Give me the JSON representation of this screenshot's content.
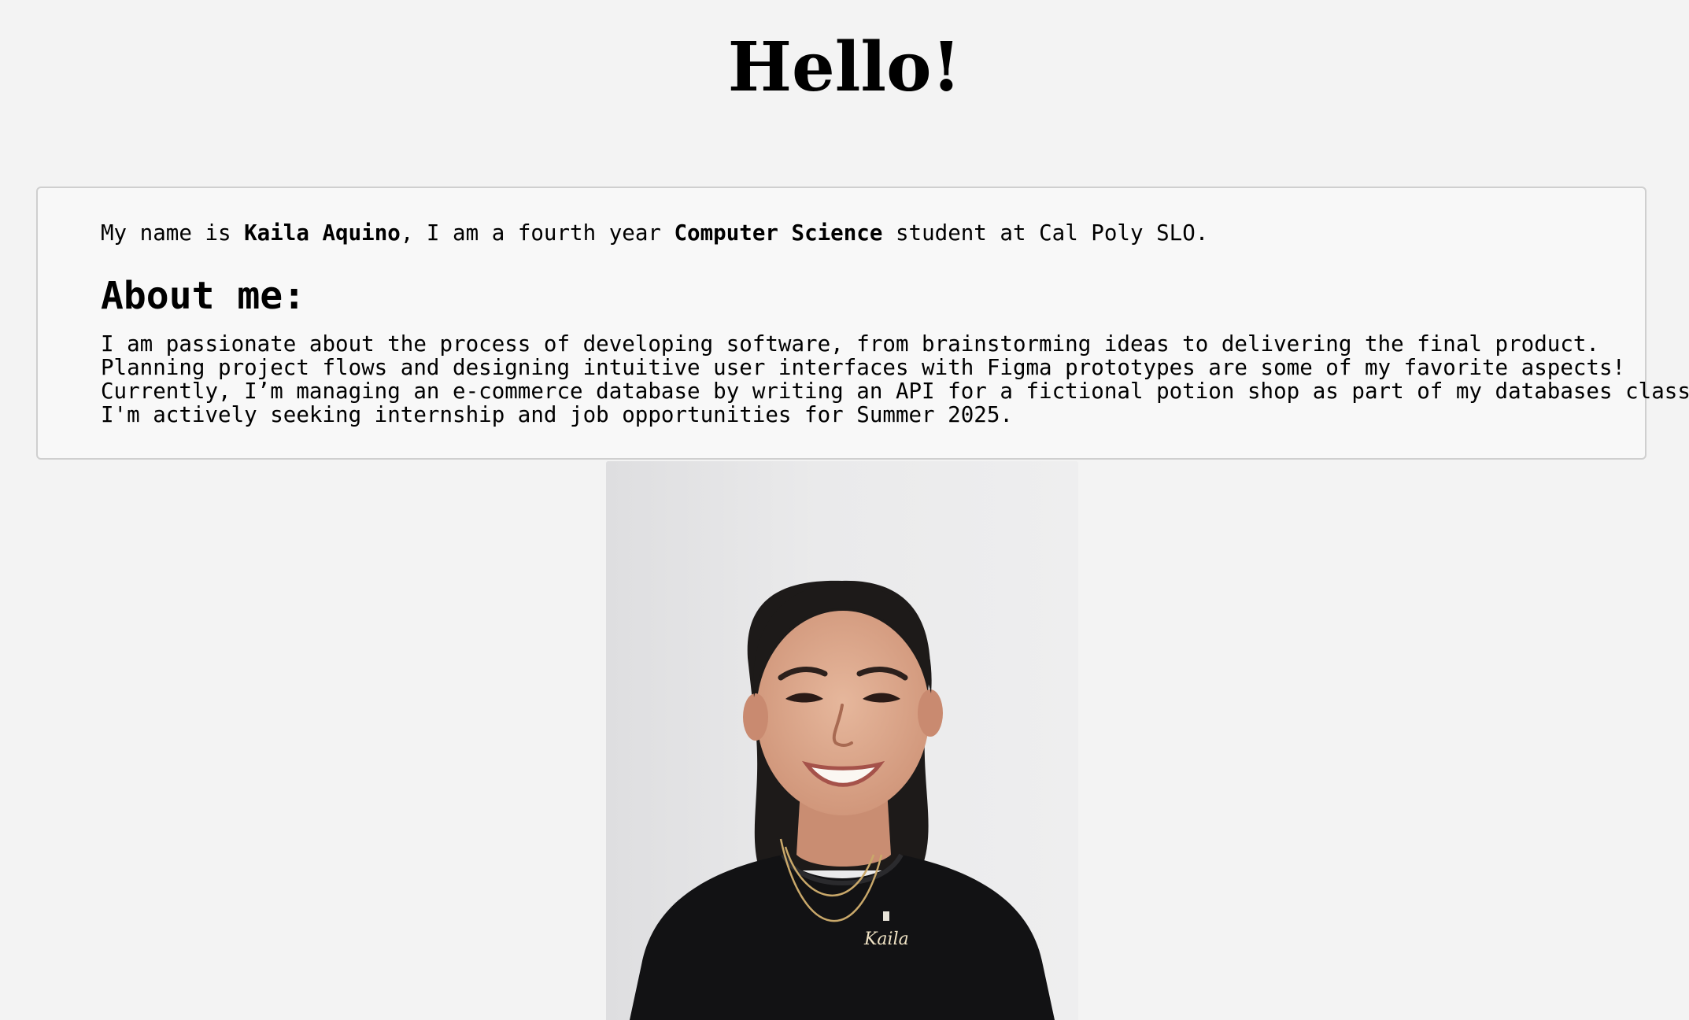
{
  "header": {
    "title": "Hello!"
  },
  "intro": {
    "prefix": "My name is ",
    "name": "Kaila Aquino",
    "middle": ", I am a fourth year ",
    "major": "Computer Science",
    "suffix": " student at Cal Poly SLO."
  },
  "about": {
    "heading": "About me:",
    "lines": [
      "I am passionate about the process of developing software, from brainstorming ideas to delivering the final product.",
      "Planning project flows and designing intuitive user interfaces with Figma prototypes are some of my favorite aspects!",
      "Currently, I’m managing an e-commerce database by writing an API for a fictional potion shop as part of my databases class.",
      "I'm actively seeking internship and job opportunities for Summer 2025."
    ]
  },
  "photo": {
    "necklace_text": "Kaila"
  }
}
